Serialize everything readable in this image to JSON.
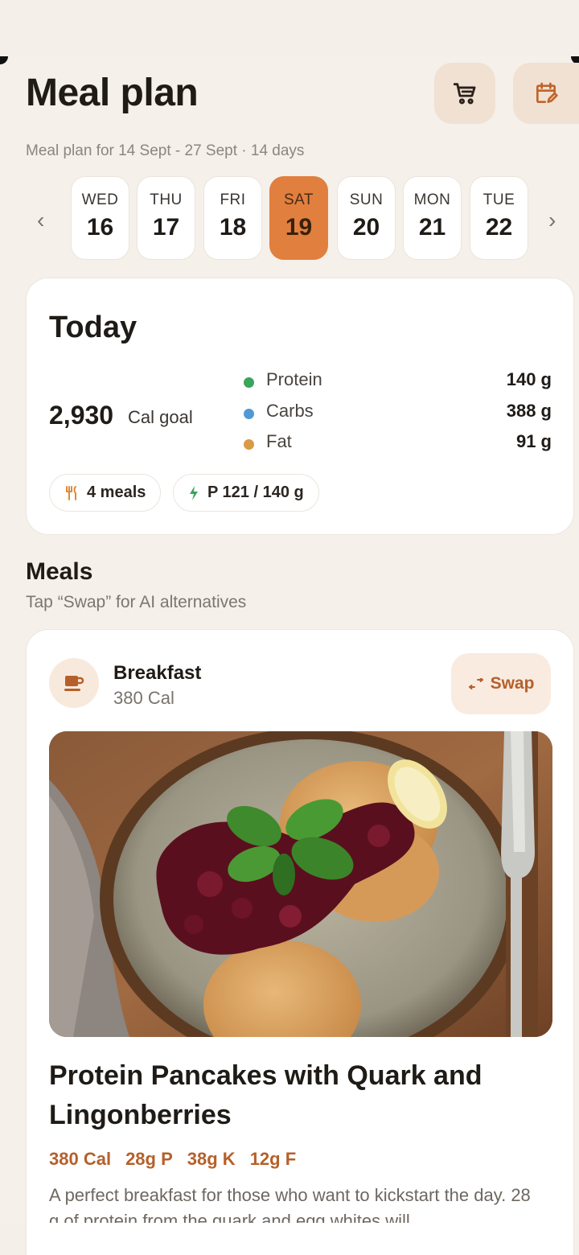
{
  "header": {
    "title": "Meal plan",
    "subtitle": "Meal plan for 14 Sept - 27 Sept · 14 days",
    "cart_icon": "cart-icon",
    "calendar_icon": "calendar-edit-icon"
  },
  "days": [
    {
      "dow": "WED",
      "num": "16"
    },
    {
      "dow": "THU",
      "num": "17"
    },
    {
      "dow": "FRI",
      "num": "18"
    },
    {
      "dow": "SAT",
      "num": "19",
      "selected": true
    },
    {
      "dow": "SUN",
      "num": "20"
    },
    {
      "dow": "MON",
      "num": "21"
    },
    {
      "dow": "TUE",
      "num": "22"
    }
  ],
  "today": {
    "title": "Today",
    "calories": "2,930",
    "calories_label": "Cal goal",
    "macros": [
      {
        "name": "Protein",
        "value": "140 g",
        "color": "#3aa55b"
      },
      {
        "name": "Carbs",
        "value": "388 g",
        "color": "#4f9ad6"
      },
      {
        "name": "Fat",
        "value": "91 g",
        "color": "#d99a45"
      }
    ],
    "chips": {
      "meals": "4 meals",
      "protein": "P 121 / 140 g"
    }
  },
  "meals_section": {
    "title": "Meals",
    "subtitle": "Tap “Swap” for AI alternatives"
  },
  "meal": {
    "type": "Breakfast",
    "calories": "380 Cal",
    "swap_label": "Swap",
    "recipe_title": "Protein Pancakes with Quark and Lingonberries",
    "macros": [
      "380 Cal",
      "28g P",
      "38g K",
      "12g F"
    ],
    "description": "A perfect breakfast for those who want to kickstart the day. 28 g of protein from the quark and egg whites will"
  },
  "colors": {
    "accent": "#e17f3e",
    "accent_text": "#b5602a",
    "background": "#f5f0e9"
  }
}
